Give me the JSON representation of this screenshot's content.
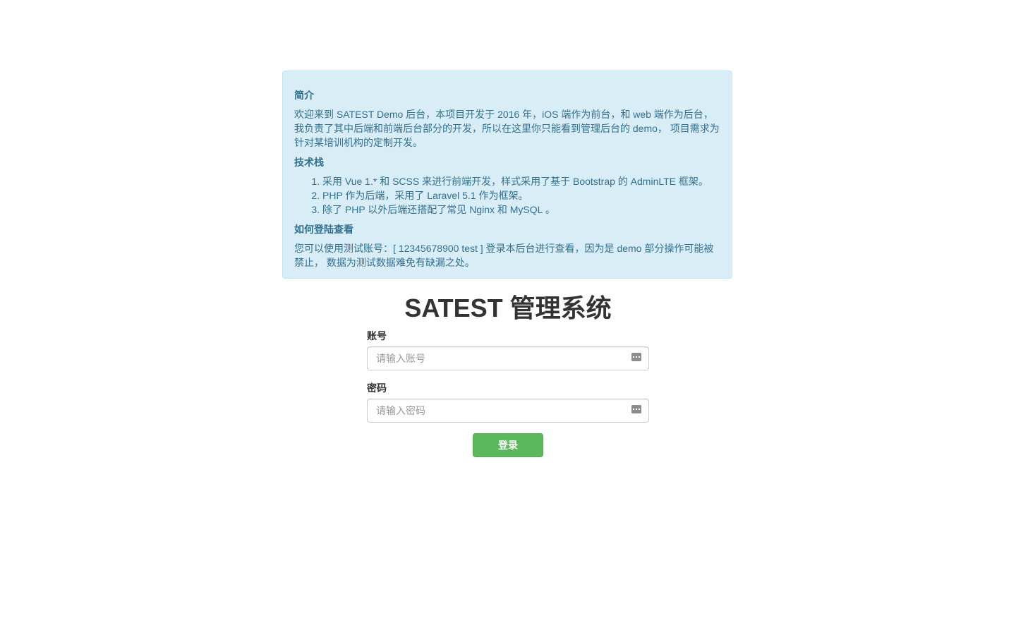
{
  "intro": {
    "title": "简介",
    "text": "欢迎来到 SATEST Demo 后台，本项目开发于 2016 年，iOS 端作为前台，和 web 端作为后台，我负责了其中后端和前端后台部分的开发，所以在这里你只能看到管理后台的 demo， 项目需求为针对某培训机构的定制开发。"
  },
  "tech": {
    "title": "技术栈",
    "items": [
      "采用 Vue 1.* 和 SCSS 来进行前端开发，样式采用了基于 Bootstrap 的 AdminLTE 框架。",
      "PHP 作为后端，采用了 Laravel 5.1 作为框架。",
      "除了 PHP 以外后端还搭配了常见 Nginx 和 MySQL 。"
    ]
  },
  "login_help": {
    "title": "如何登陆查看",
    "text": "您可以使用测试账号：[ 12345678900 test ] 登录本后台进行查看，因为是 demo 部分操作可能被禁止， 数据为测试数据难免有缺漏之处。"
  },
  "app_title": "SATEST 管理系统",
  "form": {
    "account_label": "账号",
    "account_placeholder": "请输入账号",
    "account_value": "",
    "password_label": "密码",
    "password_placeholder": "请输入密码",
    "password_value": "",
    "submit_label": "登录"
  },
  "colors": {
    "info_bg": "#d9edf7",
    "info_text": "#31708f",
    "button_bg": "#5cb85c"
  },
  "icons": {
    "field_autofill": "keychain-icon"
  }
}
